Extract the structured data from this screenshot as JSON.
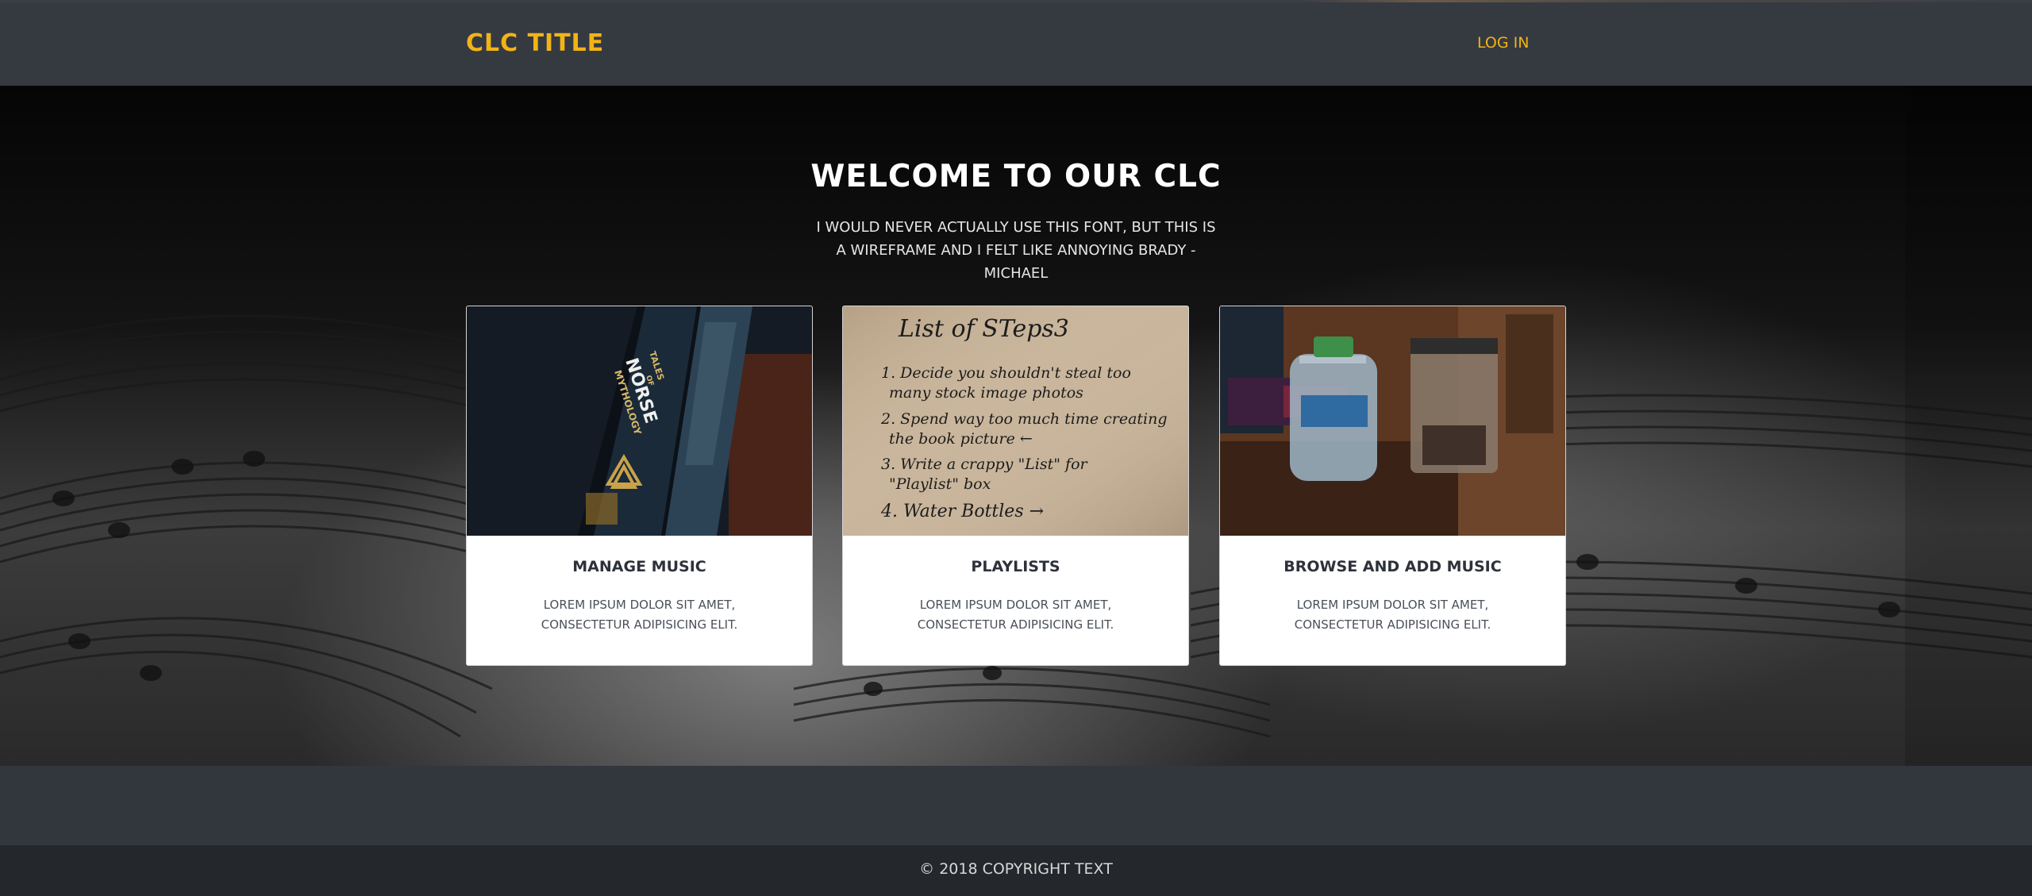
{
  "navbar": {
    "brand": "CLC TITLE",
    "login": "LOG IN"
  },
  "hero": {
    "title": "WELCOME TO OUR CLC",
    "subtitle": "I WOULD NEVER ACTUALLY USE THIS FONT, BUT THIS IS A WIREFRAME AND I FELT LIKE ANNOYING BRADY - MICHAEL"
  },
  "cards": [
    {
      "image": "norse-mythology-book-photo",
      "book_spine": [
        "TALES",
        "OF",
        "NORSE",
        "MYTHOLOGY"
      ],
      "title": "MANAGE MUSIC",
      "text": "LOREM IPSUM DOLOR SIT AMET, CONSECTETUR ADIPISICING ELIT."
    },
    {
      "image": "handwritten-list-photo",
      "note_lines": [
        "List of STeps3",
        "1. Decide you shouldn't steal too",
        "many stock image photos",
        "2. Spend way too much time creating",
        "the book picture ←",
        "3. Write a crappy \"List\" for",
        "\"Playlist\" box",
        "4. Water Bottles →"
      ],
      "title": "PLAYLISTS",
      "text": "LOREM IPSUM DOLOR SIT AMET, CONSECTETUR ADIPISICING ELIT."
    },
    {
      "image": "water-bottles-photo",
      "title": "BROWSE AND ADD MUSIC",
      "text": "LOREM IPSUM DOLOR SIT AMET, CONSECTETUR ADIPISICING ELIT."
    }
  ],
  "footer": {
    "copyright": "© 2018 COPYRIGHT TEXT"
  },
  "colors": {
    "accent": "#f2b316",
    "navbar": "#353a41",
    "footer": "#24272c"
  }
}
